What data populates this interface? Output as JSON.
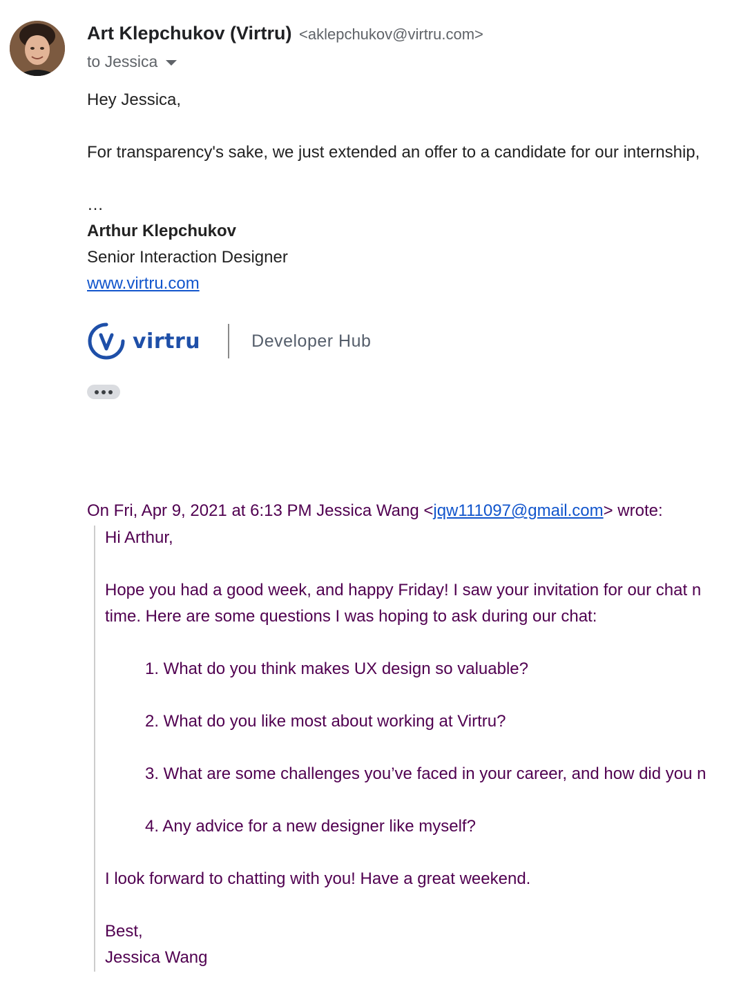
{
  "sender": {
    "name": "Art Klepchukov (Virtru)",
    "email": "<aklepchukov@virtru.com>",
    "recipient_label": "to Jessica"
  },
  "message": {
    "greeting": "Hey Jessica,",
    "line1": "For transparency's sake, we just extended an offer to a candidate for our internship,",
    "ellipsis": "…"
  },
  "signature": {
    "name": "Arthur Klepchukov",
    "title": "Senior Interaction Designer",
    "website": "www.virtru.com",
    "logo_text": "virtru",
    "logo_subtitle": "Developer Hub"
  },
  "quoted": {
    "header_prefix": "On Fri, Apr 9, 2021 at 6:13 PM Jessica Wang <",
    "header_email": "jqw111097@gmail.com",
    "header_suffix": "> wrote:",
    "greeting": "Hi Arthur,",
    "para1_line1": "Hope you had a good week, and happy Friday! I saw your invitation for our chat n",
    "para1_line2": "time. Here are some questions I was hoping to ask during our chat:",
    "questions": [
      "1. What do you think makes UX design so valuable?",
      "2. What do you like most about working at Virtru?",
      "3. What are some challenges you’ve faced in your career, and how did you n",
      "4. Any advice for a new designer like myself?"
    ],
    "closing_line": "I look forward to chatting with you! Have a great weekend.",
    "signoff": "Best,",
    "signer": "Jessica Wang"
  },
  "colors": {
    "link": "#1155cc",
    "quoted_text": "#500050",
    "brand": "#1e4fa8"
  },
  "icons": {
    "dropdown": "chevron-down-icon",
    "more": "more-horizontal-icon"
  }
}
